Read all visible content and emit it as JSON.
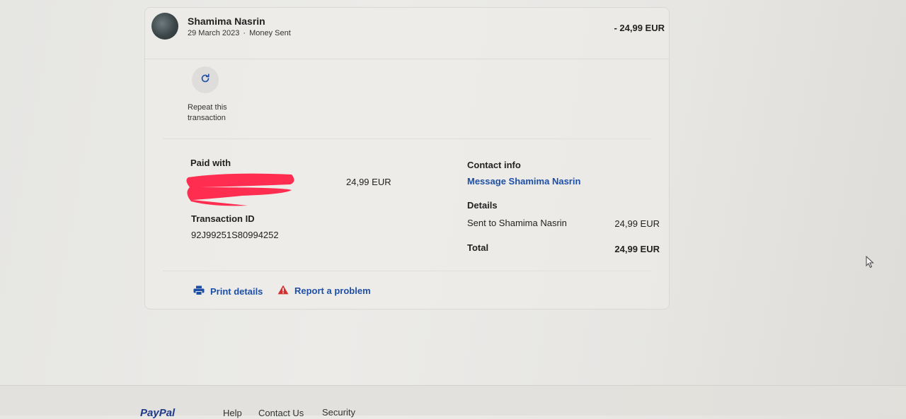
{
  "transaction": {
    "recipient_name": "Shamima Nasrin",
    "date": "29 March 2023",
    "type": "Money Sent",
    "amount": "- 24,99 EUR"
  },
  "repeat": {
    "icon": "refresh-icon",
    "label": "Repeat this transaction"
  },
  "paid_with": {
    "label": "Paid with",
    "amount": "24,99 EUR"
  },
  "transaction_id": {
    "label": "Transaction ID",
    "value": "92J99251S80994252"
  },
  "contact": {
    "label": "Contact info",
    "link": "Message Shamima Nasrin"
  },
  "details": {
    "label": "Details",
    "rows": [
      {
        "label": "Sent to Shamima Nasrin",
        "value": "24,99 EUR"
      }
    ],
    "total_label": "Total",
    "total_value": "24,99 EUR"
  },
  "actions": {
    "print": "Print details",
    "report": "Report a problem"
  },
  "footer": {
    "logo": "PayPal",
    "links": [
      "Help",
      "Contact Us",
      "Security"
    ]
  },
  "colors": {
    "link": "#1e4fa7",
    "warning": "#d32f2f",
    "redaction": "#ff2d4f"
  }
}
